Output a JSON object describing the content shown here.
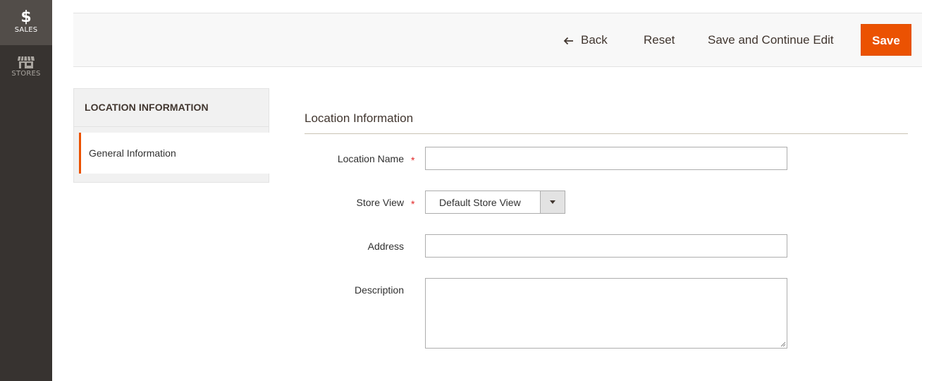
{
  "nav": {
    "sales": {
      "glyph": "$",
      "label": "SALES",
      "icon": "dollar-icon"
    },
    "stores": {
      "label": "STORES",
      "icon": "storefront-icon"
    }
  },
  "actions": {
    "back_label": "Back",
    "reset_label": "Reset",
    "continue_label": "Save and Continue Edit",
    "save_label": "Save"
  },
  "side": {
    "heading": "LOCATION INFORMATION",
    "items": [
      {
        "label": "General Information",
        "active": true
      }
    ]
  },
  "form": {
    "title": "Location Information",
    "fields": {
      "location_name": {
        "label": "Location Name",
        "required": "*",
        "value": ""
      },
      "store_view": {
        "label": "Store View",
        "required": "*",
        "value": "Default Store View"
      },
      "address": {
        "label": "Address",
        "value": ""
      },
      "description": {
        "label": "Description",
        "value": ""
      }
    }
  },
  "colors": {
    "accent": "#eb5202",
    "nav_bg": "#373330",
    "required": "#e22626"
  }
}
